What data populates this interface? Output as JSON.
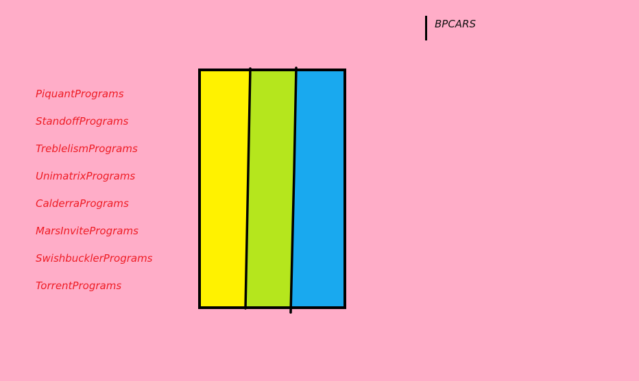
{
  "header": {
    "brand": "BPCARS"
  },
  "menu": {
    "items": [
      "PiquantPrograms",
      "StandoffPrograms",
      "TreblelismPrograms",
      "UnimatrixPrograms",
      "CalderraPrograms",
      "MarsInvitePrograms",
      "SwishbucklerPrograms",
      "TorrentPrograms"
    ]
  },
  "stripes": {
    "colors": [
      "#fff200",
      "#b5e61d",
      "#19a9ef"
    ],
    "outline": "#000000"
  },
  "colors": {
    "background": "#ffadc8",
    "menu_text": "#ee1c24",
    "brand_text": "#111111"
  }
}
